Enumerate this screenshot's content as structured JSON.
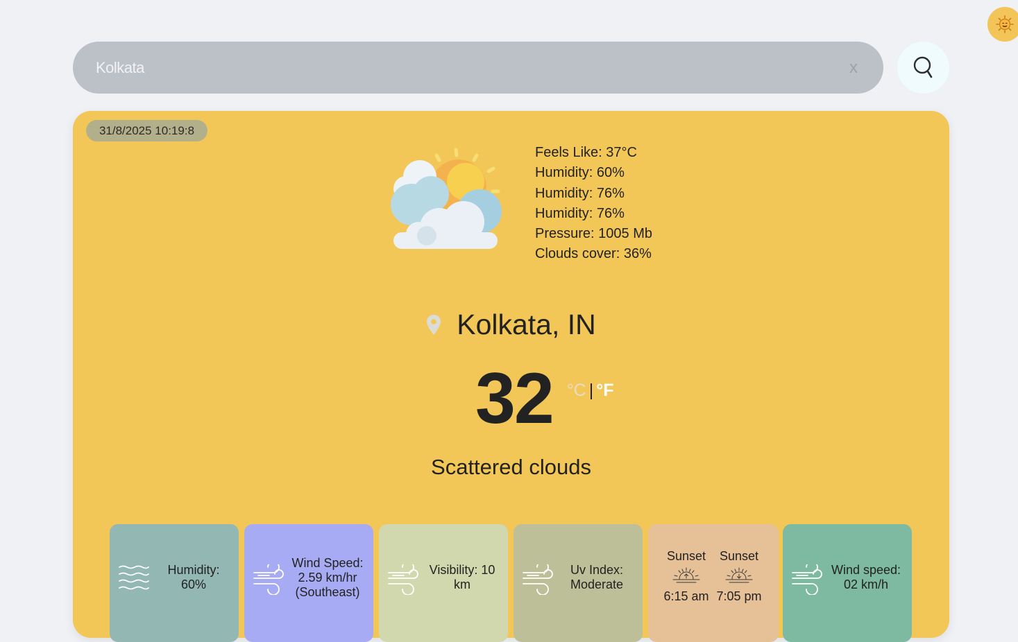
{
  "search": {
    "value": "Kolkata",
    "clear_label": "x"
  },
  "card": {
    "datetime": "31/8/2025 10:19:8",
    "details": [
      "Feels Like: 37°C",
      "Humidity: 60%",
      "Humidity: 76%",
      "Humidity: 76%",
      "Pressure: 1005 Mb",
      "Clouds cover: 36%"
    ],
    "location": "Kolkata, IN",
    "temperature": "32",
    "unit_c": "°C",
    "unit_separator": "|",
    "unit_f": "°F",
    "condition": "Scattered clouds"
  },
  "tiles": {
    "humidity": {
      "line1": "Humidity:",
      "line2": "60%"
    },
    "wind": {
      "line1": "Wind Speed:",
      "line2": "2.59 km/hr",
      "line3": "(Southeast)"
    },
    "visibility": {
      "line1": "Visibility: 10",
      "line2": "km"
    },
    "uv": {
      "line1": "Uv Index:",
      "line2": "Moderate"
    },
    "sun": {
      "rise_title": "Sunset",
      "rise_time": "6:15 am",
      "set_title": "Sunset",
      "set_time": "7:05 pm"
    },
    "wind2": {
      "line1": "Wind speed:",
      "line2": "02 km/h"
    }
  },
  "colors": {
    "card": "#f3c658",
    "tile_humidity": "#93b7b3",
    "tile_wind": "#a7abf3",
    "tile_visibility": "#d2d8ad",
    "tile_uv": "#bdbf98",
    "tile_sun": "#e6c097",
    "tile_wind2": "#7eb9a1"
  },
  "icons": {
    "avatar": "smiling-sun-icon",
    "search": "search-icon",
    "weather": "partly-cloudy-sun-icon",
    "location": "map-pin-icon",
    "humidity": "waves-icon",
    "wind": "wind-icon",
    "sunrise": "sunrise-icon",
    "sunset": "sunset-icon"
  }
}
